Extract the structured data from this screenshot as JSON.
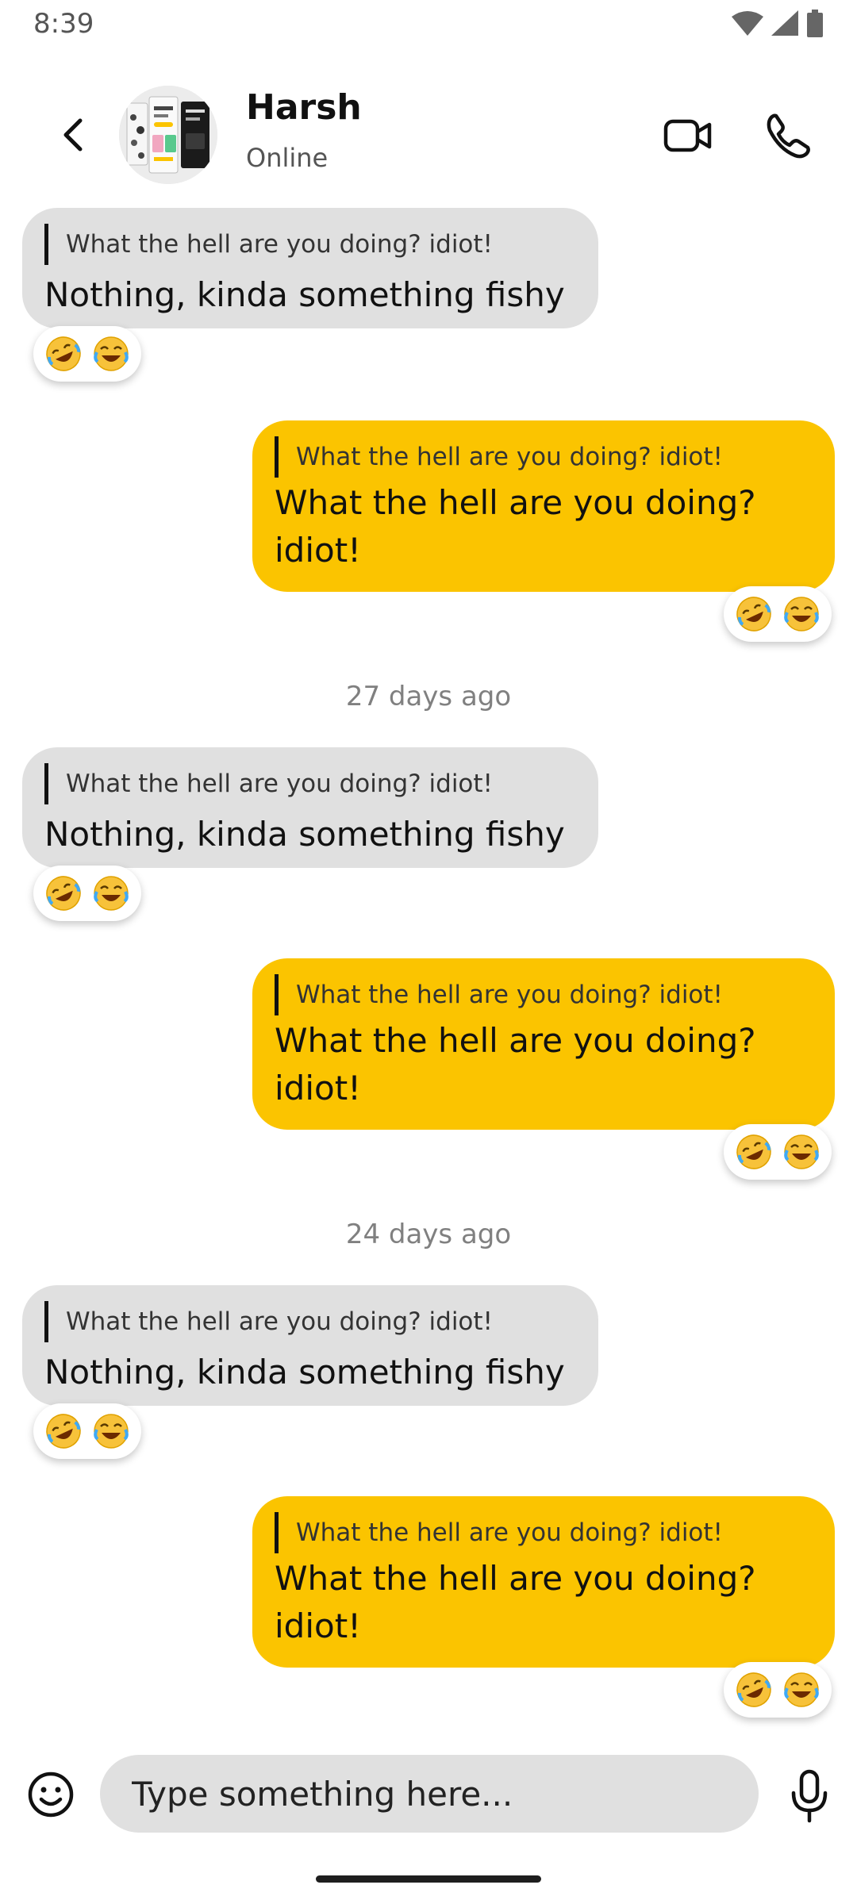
{
  "status_bar": {
    "time": "8:39"
  },
  "header": {
    "contact_name": "Harsh",
    "contact_status": "Online"
  },
  "messages": [
    {
      "direction": "in",
      "quote": "What the hell are you doing? idiot!",
      "text": "Nothing, kinda something fishy",
      "reactions": [
        "rolling-on-floor-laughing",
        "tears-of-joy"
      ]
    },
    {
      "direction": "out",
      "quote": "What the hell are you doing? idiot!",
      "text": "What the hell are you doing? idiot!",
      "reactions": [
        "rolling-on-floor-laughing",
        "tears-of-joy"
      ]
    },
    {
      "direction": "in",
      "quote": "What the hell are you doing? idiot!",
      "text": "Nothing, kinda something fishy",
      "reactions": [
        "rolling-on-floor-laughing",
        "tears-of-joy"
      ]
    },
    {
      "direction": "out",
      "quote": "What the hell are you doing? idiot!",
      "text": "What the hell are you doing? idiot!",
      "reactions": [
        "rolling-on-floor-laughing",
        "tears-of-joy"
      ]
    },
    {
      "direction": "in",
      "quote": "What the hell are you doing? idiot!",
      "text": "Nothing, kinda something fishy",
      "reactions": [
        "rolling-on-floor-laughing",
        "tears-of-joy"
      ]
    },
    {
      "direction": "out",
      "quote": "What the hell are you doing? idiot!",
      "text": "What the hell are you doing? idiot!",
      "reactions": [
        "rolling-on-floor-laughing",
        "tears-of-joy"
      ]
    }
  ],
  "date_separators": [
    "27 days ago",
    "24 days ago"
  ],
  "composer": {
    "placeholder": "Type something here..."
  },
  "colors": {
    "outgoing_bubble": "#fbc400",
    "incoming_bubble": "#e0e0e0",
    "input_background": "#e0e0e0"
  }
}
